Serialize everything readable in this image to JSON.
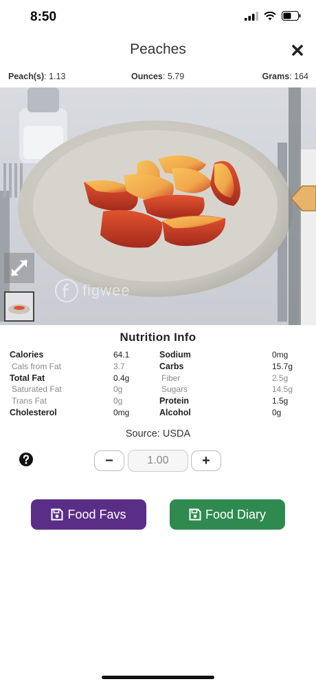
{
  "status_bar": {
    "time": "8:50"
  },
  "header": {
    "title": "Peaches",
    "close_icon": "close-icon"
  },
  "measures": [
    {
      "label": "Peach(s)",
      "value": "1.13"
    },
    {
      "label": "Ounces",
      "value": "5.79"
    },
    {
      "label": "Grams",
      "value": "164"
    }
  ],
  "photo": {
    "watermark": "figwee",
    "expand_icon": "expand-icon"
  },
  "nutrition": {
    "title": "Nutrition Info",
    "left": [
      {
        "label": "Calories",
        "value": "64.1",
        "main": true
      },
      {
        "label": "Cals from Fat",
        "value": "3.7",
        "main": false
      },
      {
        "label": "Total Fat",
        "value": "0.4g",
        "main": true
      },
      {
        "label": "Saturated Fat",
        "value": "0g",
        "main": false
      },
      {
        "label": "Trans Fat",
        "value": "0g",
        "main": false
      },
      {
        "label": "Cholesterol",
        "value": "0mg",
        "main": true
      }
    ],
    "right": [
      {
        "label": "Sodium",
        "value": "0mg",
        "main": true
      },
      {
        "label": "Carbs",
        "value": "15.7g",
        "main": true
      },
      {
        "label": "Fiber",
        "value": "2.5g",
        "main": false
      },
      {
        "label": "Sugars",
        "value": "14.5g",
        "main": false
      },
      {
        "label": "Protein",
        "value": "1.5g",
        "main": true
      },
      {
        "label": "Alcohol",
        "value": "0g",
        "main": true
      }
    ]
  },
  "source": "Source: USDA",
  "quantity": {
    "minus": "−",
    "plus": "+",
    "value": "1.00"
  },
  "buttons": {
    "favs": "Food Favs",
    "diary": "Food Diary"
  },
  "colors": {
    "favs": "#5a2d86",
    "diary": "#2f8a4f"
  }
}
